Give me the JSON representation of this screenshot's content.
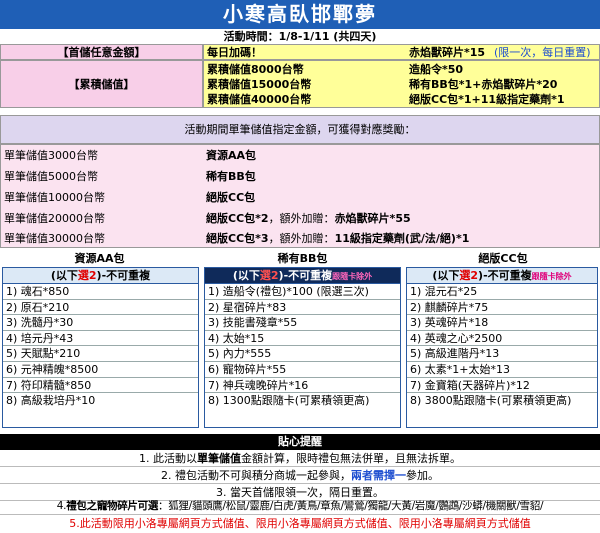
{
  "banner": {
    "title": "小寒高臥邯鄲夢"
  },
  "period": "活動時間：1/8-1/11 (共四天)",
  "first_deposit": {
    "label": "【首儲任意金額】",
    "reward": "每日加碼！",
    "bonus": "赤焰獸碎片*15",
    "bonus_note": "(限一次，每日重置)"
  },
  "cumulative": {
    "label": "【累積儲值】",
    "tiers": [
      {
        "amount": "累積儲值8000台幣",
        "reward": "造船令*50"
      },
      {
        "amount": "累積儲值15000台幣",
        "reward": "稀有BB包*1+赤焰獸碎片*20"
      },
      {
        "amount": "累積儲值40000台幣",
        "reward": "絕版CC包*1+11級指定藥劑*1"
      }
    ]
  },
  "single": {
    "intro": "活動期間單筆儲值指定金額，可獲得對應獎勵：",
    "tiers": [
      {
        "amount": "單筆儲值3000台幣",
        "reward": "資源AA包",
        "extra_label": "",
        "extra": ""
      },
      {
        "amount": "單筆儲值5000台幣",
        "reward": "稀有BB包",
        "extra_label": "",
        "extra": ""
      },
      {
        "amount": "單筆儲值10000台幣",
        "reward": "絕版CC包",
        "extra_label": "",
        "extra": ""
      },
      {
        "amount": "單筆儲值20000台幣",
        "reward": "絕版CC包*2",
        "extra_label": "，額外加贈：",
        "extra": "赤焰獸碎片*55"
      },
      {
        "amount": "單筆儲值30000台幣",
        "reward": "絕版CC包*3",
        "extra_label": "，額外加贈：",
        "extra": "11級指定藥劑(武/法/絕)*1"
      }
    ]
  },
  "packages": [
    {
      "title": "資源AA包",
      "rule_pre": "(以下",
      "rule_pick": "選2",
      "rule_post": ")-不可重複",
      "rule_note": "",
      "items": [
        "1) 魂石*850",
        "2) 原石*210",
        "3) 洗髓丹*30",
        "4) 培元丹*43",
        "5) 天賦點*210",
        "6) 元神精魄*8500",
        "7) 符印精髓*850",
        "8) 高級栽培丹*10"
      ]
    },
    {
      "title": "稀有BB包",
      "rule_pre": "(以下",
      "rule_pick": "選2",
      "rule_post": ")-不可重複",
      "rule_note": "跟隨卡除外",
      "items": [
        "1) 造船令(禮包)*100 (限選三次)",
        "2) 星宿碎片*83",
        "3) 技能書殘章*55",
        "4) 太始*15",
        "5) 內力*555",
        "6) 寵物碎片*55",
        "7) 神兵魂晚碎片*16",
        "8) 1300點跟隨卡(可累積領更高)"
      ]
    },
    {
      "title": "絕版CC包",
      "rule_pre": "(以下",
      "rule_pick": "選2",
      "rule_post": ")-不可重複",
      "rule_note": "跟隨卡除外",
      "items": [
        "1) 混元石*25",
        "2) 麒麟碎片*75",
        "3) 英魂碎片*18",
        "4) 英魂之心*2500",
        "5) 高級進階丹*13",
        "6) 太素*1+太始*13",
        "7) 金寶箱(天器碎片)*12",
        "8) 3800點跟隨卡(可累積領更高)"
      ]
    }
  ],
  "tips": {
    "title": "貼心提醒",
    "line1_pre": "1. 此活動以",
    "line1_bold": "單筆儲值",
    "line1_post": "金額計算，限時禮包無法併單，且無法拆單。",
    "line2_pre": "2. 禮包活動不可與積分商城一起參與，",
    "line2_hl": "兩者需擇一",
    "line2_post": "參加。",
    "line3": "3. 當天首儲限領一次，隔日重置。",
    "line4_pre": "4.",
    "line4_bold": "禮包之寵物碎片可選",
    "line4_post": "：狐狸/貓頭鷹/松鼠/靈鹿/白虎/黃鳥/章魚/鸞鶯/獨龍/大黃/岩魔/鸚鵡/沙蟒/機關獸/雪貂/",
    "line5": "5.此活動限用小洛專屬網頁方式儲值、限用小洛專屬網頁方式儲值、限用小洛專屬網頁方式儲值"
  }
}
